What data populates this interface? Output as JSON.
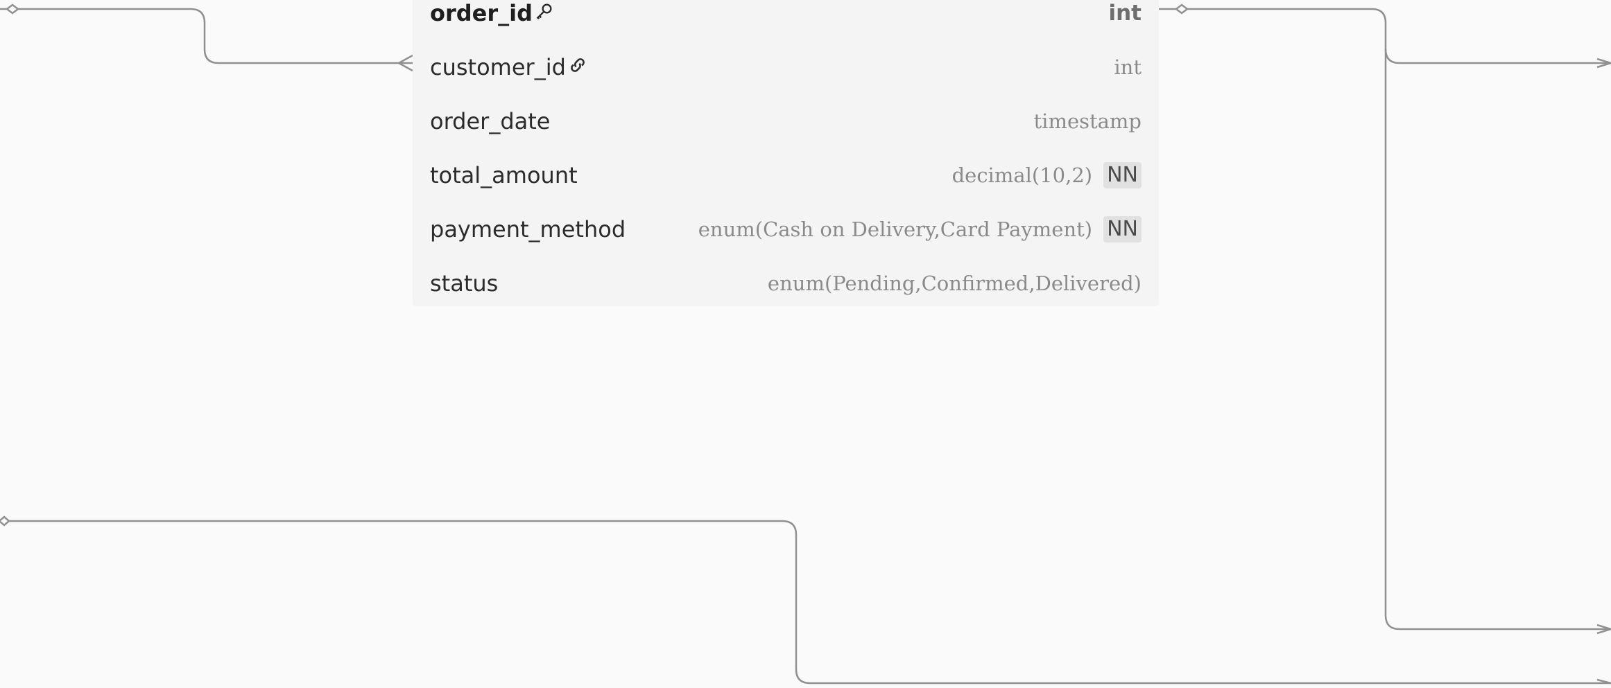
{
  "table": {
    "columns": [
      {
        "name": "order_id",
        "type": "int",
        "primary_key": true,
        "icon": "key-icon",
        "badge": ""
      },
      {
        "name": "customer_id",
        "type": "int",
        "primary_key": false,
        "icon": "link-icon",
        "badge": ""
      },
      {
        "name": "order_date",
        "type": "timestamp",
        "primary_key": false,
        "icon": "",
        "badge": ""
      },
      {
        "name": "total_amount",
        "type": "decimal(10,2)",
        "primary_key": false,
        "icon": "",
        "badge": "NN"
      },
      {
        "name": "payment_method",
        "type": "enum(Cash on Delivery,Card Payment)",
        "primary_key": false,
        "icon": "",
        "badge": "NN"
      },
      {
        "name": "status",
        "type": "enum(Pending,Confirmed,Delivered)",
        "primary_key": false,
        "icon": "",
        "badge": ""
      }
    ]
  },
  "colors": {
    "canvas": "#fafafa",
    "card": "#f4f4f4",
    "connector": "#909090",
    "badge": "#e1e1e1"
  }
}
